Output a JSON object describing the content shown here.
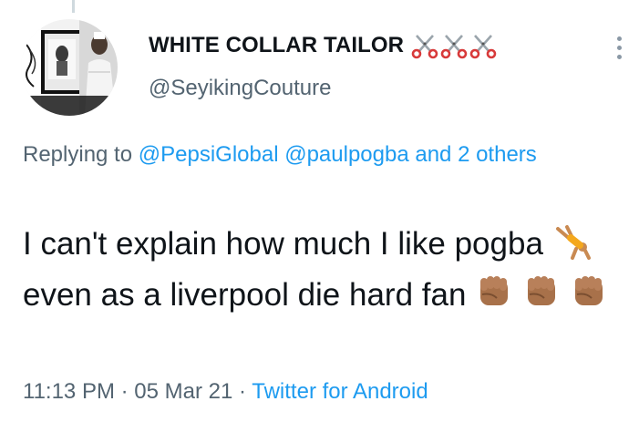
{
  "colors": {
    "link": "#1d9bf0",
    "secondary_text": "#536471",
    "primary_text": "#0f1419",
    "thread_line": "#cfd9de"
  },
  "author": {
    "display_name": "WHITE COLLAR TAILOR",
    "name_emojis": [
      "scissors-icon",
      "scissors-icon",
      "scissors-icon"
    ],
    "handle": "@SeyikingCouture",
    "avatar": "avatar-image"
  },
  "menu": {
    "icon": "more-vertical-icon"
  },
  "reply_context": {
    "prefix": "Replying to",
    "mention_1": "@PepsiGlobal",
    "mention_2": "@paulpogba",
    "and_more": "and 2 others"
  },
  "tweet": {
    "text_part_1": "I can't explain how much I like pogba",
    "text_part_2": "even as a liverpool die hard fan",
    "emojis": [
      "cartwheel-emoji",
      "raised-fist-emoji",
      "raised-fist-emoji",
      "raised-fist-emoji"
    ]
  },
  "meta": {
    "time": "11:13 PM",
    "separator": "·",
    "date": "05 Mar 21",
    "source": "Twitter for Android"
  }
}
